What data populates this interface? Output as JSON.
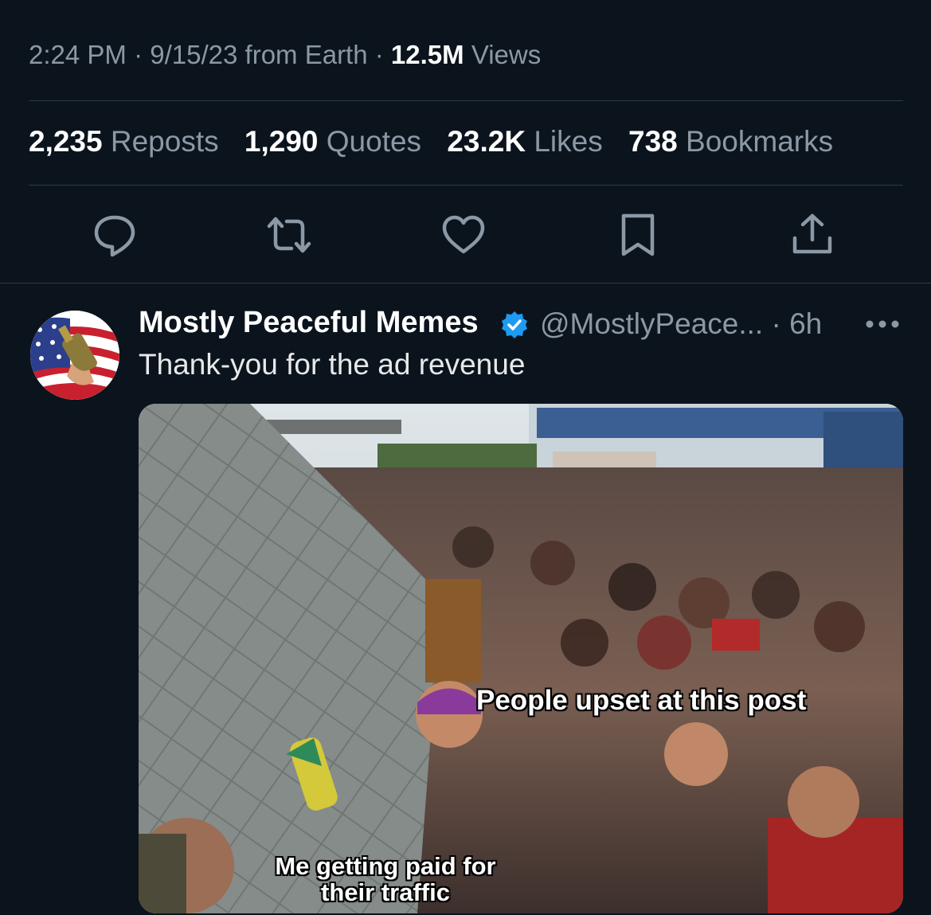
{
  "meta": {
    "time": "2:24 PM",
    "date": "9/15/23",
    "source": "from Earth",
    "views_count": "12.5M",
    "views_label": "Views"
  },
  "stats": [
    {
      "count": "2,235",
      "label": "Reposts"
    },
    {
      "count": "1,290",
      "label": "Quotes"
    },
    {
      "count": "23.2K",
      "label": "Likes"
    },
    {
      "count": "738",
      "label": "Bookmarks"
    }
  ],
  "actions": [
    "reply-icon",
    "repost-icon",
    "like-icon",
    "bookmark-icon",
    "share-icon"
  ],
  "reply": {
    "display_name": "Mostly Peaceful Memes",
    "handle": "@MostlyPeace...",
    "age": "6h",
    "text": "Thank-you for the ad revenue",
    "media": {
      "caption_top": "People upset at this post",
      "caption_bottom": "Me getting paid for their traffic"
    }
  },
  "colors": {
    "background": "#0b141d",
    "muted": "#8b98a5",
    "divider": "#2f3943",
    "verified": "#1d9bf0"
  }
}
